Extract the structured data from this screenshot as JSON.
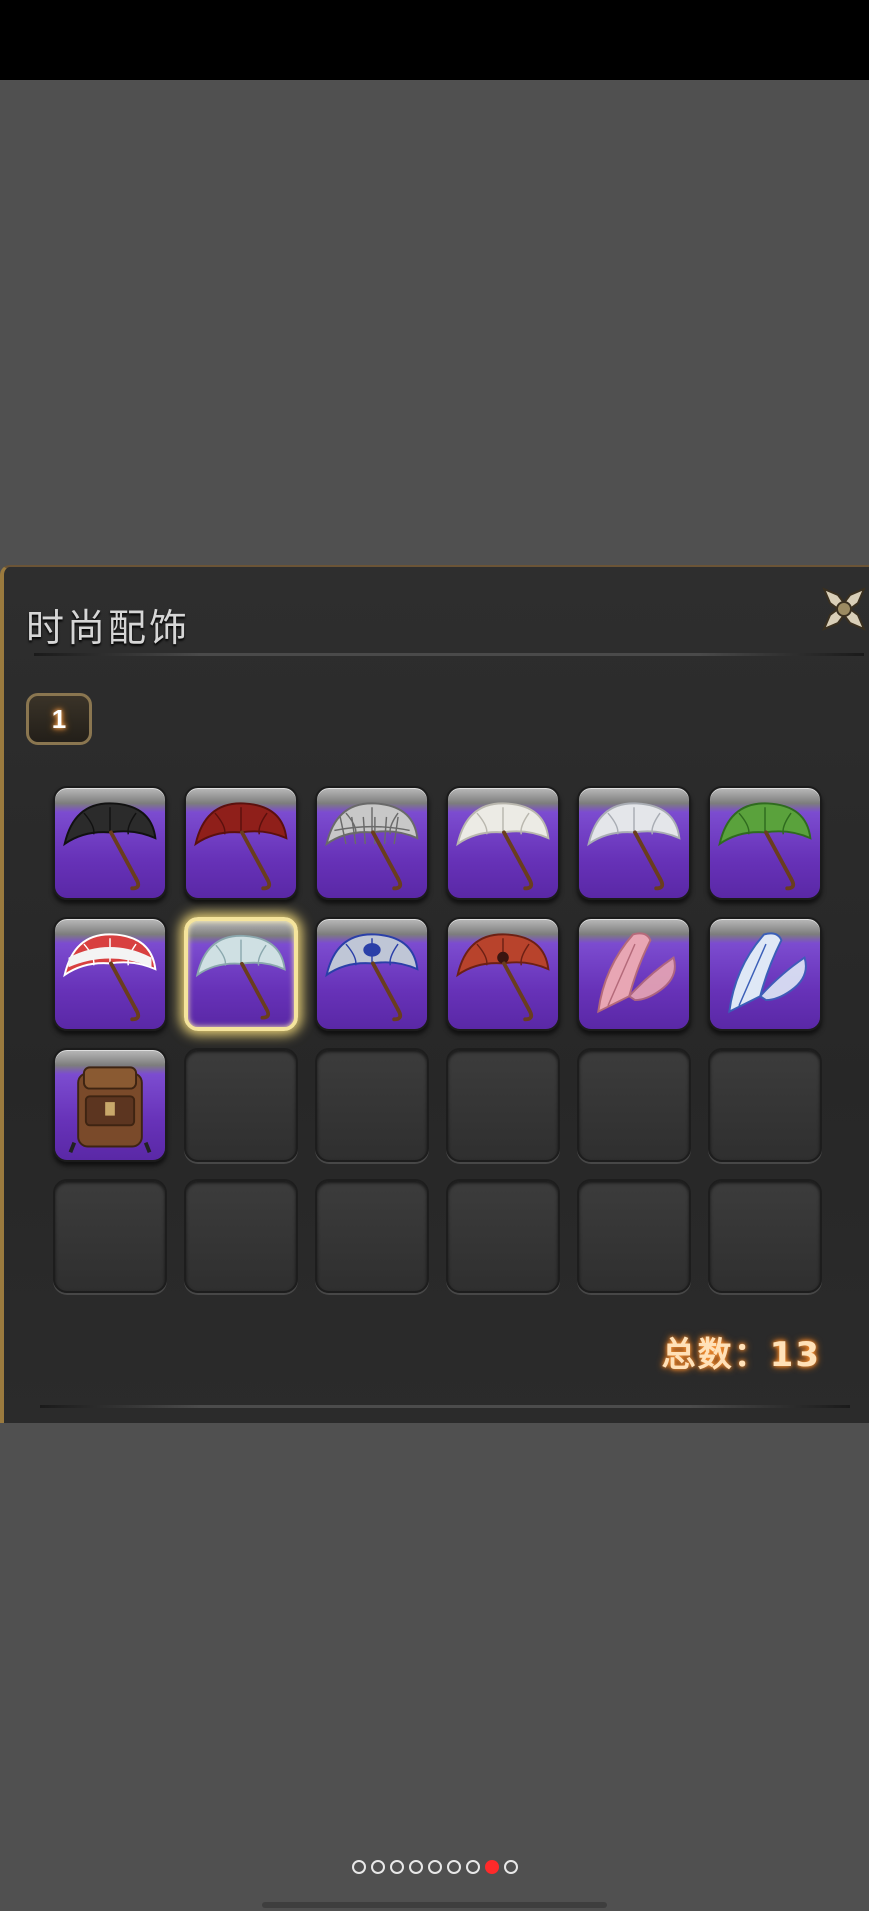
{
  "window": {
    "title": "时尚配饰",
    "close_icon": "crossed-blades-close-icon"
  },
  "page_tab": {
    "label": "1"
  },
  "accent_colors": {
    "slot_bg": "#6732b8",
    "selected": "#f5e49c",
    "total_glow": "#ff9a3a",
    "pager_active": "#ff2a2a"
  },
  "items": [
    {
      "icon": "black-umbrella-icon",
      "canopy": "#2b2b2b",
      "rib": "#111111"
    },
    {
      "icon": "red-parasol-icon",
      "canopy": "#8f1f1a",
      "rib": "#5b100d"
    },
    {
      "icon": "checkered-umbrella-icon",
      "canopy": "#c8c8c8",
      "rib": "#6a6a6a"
    },
    {
      "icon": "white-lace-umbrella-icon",
      "canopy": "#ecebe5",
      "rib": "#b9b7ae"
    },
    {
      "icon": "white-umbrella-icon",
      "canopy": "#e4e6ea",
      "rib": "#a9adb4"
    },
    {
      "icon": "green-leaf-umbrella-icon",
      "canopy": "#5aa23c",
      "rib": "#2f6b1f"
    },
    {
      "icon": "red-white-umbrella-icon",
      "canopy": "#d84040",
      "rib": "#ffffff"
    },
    {
      "icon": "clear-umbrella-icon",
      "canopy": "#cfe0e3",
      "rib": "#8aa7ad"
    },
    {
      "icon": "moogle-umbrella-icon",
      "canopy": "#bfc6d6",
      "rib": "#2a3fa8"
    },
    {
      "icon": "red-paper-parasol-icon",
      "canopy": "#b8432c",
      "rib": "#6c2014"
    },
    {
      "icon": "pink-butterfly-wings-icon",
      "canopy": "#e8a6b4",
      "rib": "#b46a7a"
    },
    {
      "icon": "blue-butterfly-wings-icon",
      "canopy": "#dfe8f6",
      "rib": "#3b5fb8"
    },
    {
      "icon": "leather-backpack-icon",
      "canopy": "#7a4a2a",
      "rib": "#3e2412"
    }
  ],
  "selected_index": 7,
  "slot_count": 24,
  "total": {
    "text": "总数：13"
  },
  "pager": {
    "page_count": 9,
    "active_index": 7
  }
}
